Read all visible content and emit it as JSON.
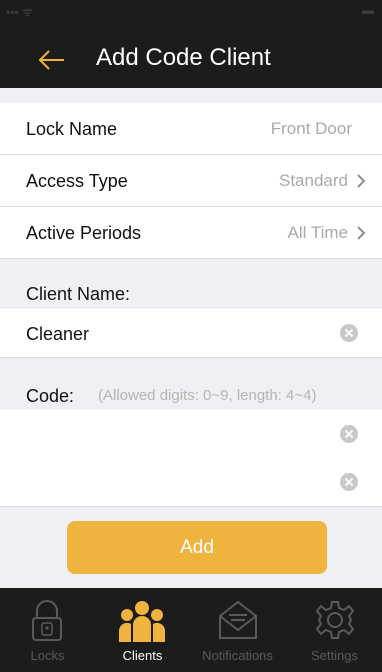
{
  "header": {
    "title": "Add Code Client",
    "accent_color": "#f0b33e"
  },
  "lock_name": {
    "label": "Lock Name",
    "value": "Front Door"
  },
  "access_type": {
    "label": "Access Type",
    "value": "Standard"
  },
  "active_periods": {
    "label": "Active Periods",
    "value": "All Time"
  },
  "client_name": {
    "label": "Client Name:",
    "value": "Cleaner"
  },
  "code": {
    "label": "Code:",
    "hint": "(Allowed digits: 0~9, length: 4~4)",
    "value": "",
    "confirm_value": ""
  },
  "add_button": {
    "label": "Add"
  },
  "tab_bar": {
    "tabs": [
      {
        "label": "Locks",
        "icon": "lock-icon",
        "active": false
      },
      {
        "label": "Clients",
        "icon": "people-icon",
        "active": true
      },
      {
        "label": "Notifications",
        "icon": "envelope-icon",
        "active": false
      },
      {
        "label": "Settings",
        "icon": "gear-icon",
        "active": false
      }
    ]
  }
}
